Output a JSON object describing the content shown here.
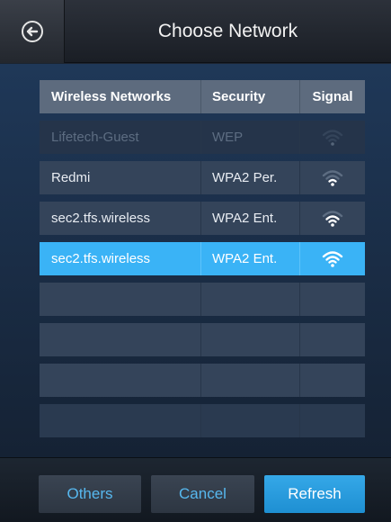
{
  "header": {
    "title": "Choose Network",
    "back_icon": "back-arrow-circle-icon"
  },
  "table": {
    "columns": [
      "Wireless Networks",
      "Security",
      "Signal"
    ],
    "rows": [
      {
        "name": "Lifetech-Guest",
        "security": "WEP",
        "signal_level": 1,
        "state": "faded"
      },
      {
        "name": "Redmi",
        "security": "WPA2 Per.",
        "signal_level": 2,
        "state": "normal"
      },
      {
        "name": "sec2.tfs.wireless",
        "security": "WPA2 Ent.",
        "signal_level": 3,
        "state": "normal"
      },
      {
        "name": "sec2.tfs.wireless",
        "security": "WPA2 Ent.",
        "signal_level": 4,
        "state": "selected"
      }
    ]
  },
  "footer": {
    "others_label": "Others",
    "cancel_label": "Cancel",
    "refresh_label": "Refresh"
  },
  "colors": {
    "accent": "#3ab3f6",
    "link": "#57b8ef"
  }
}
